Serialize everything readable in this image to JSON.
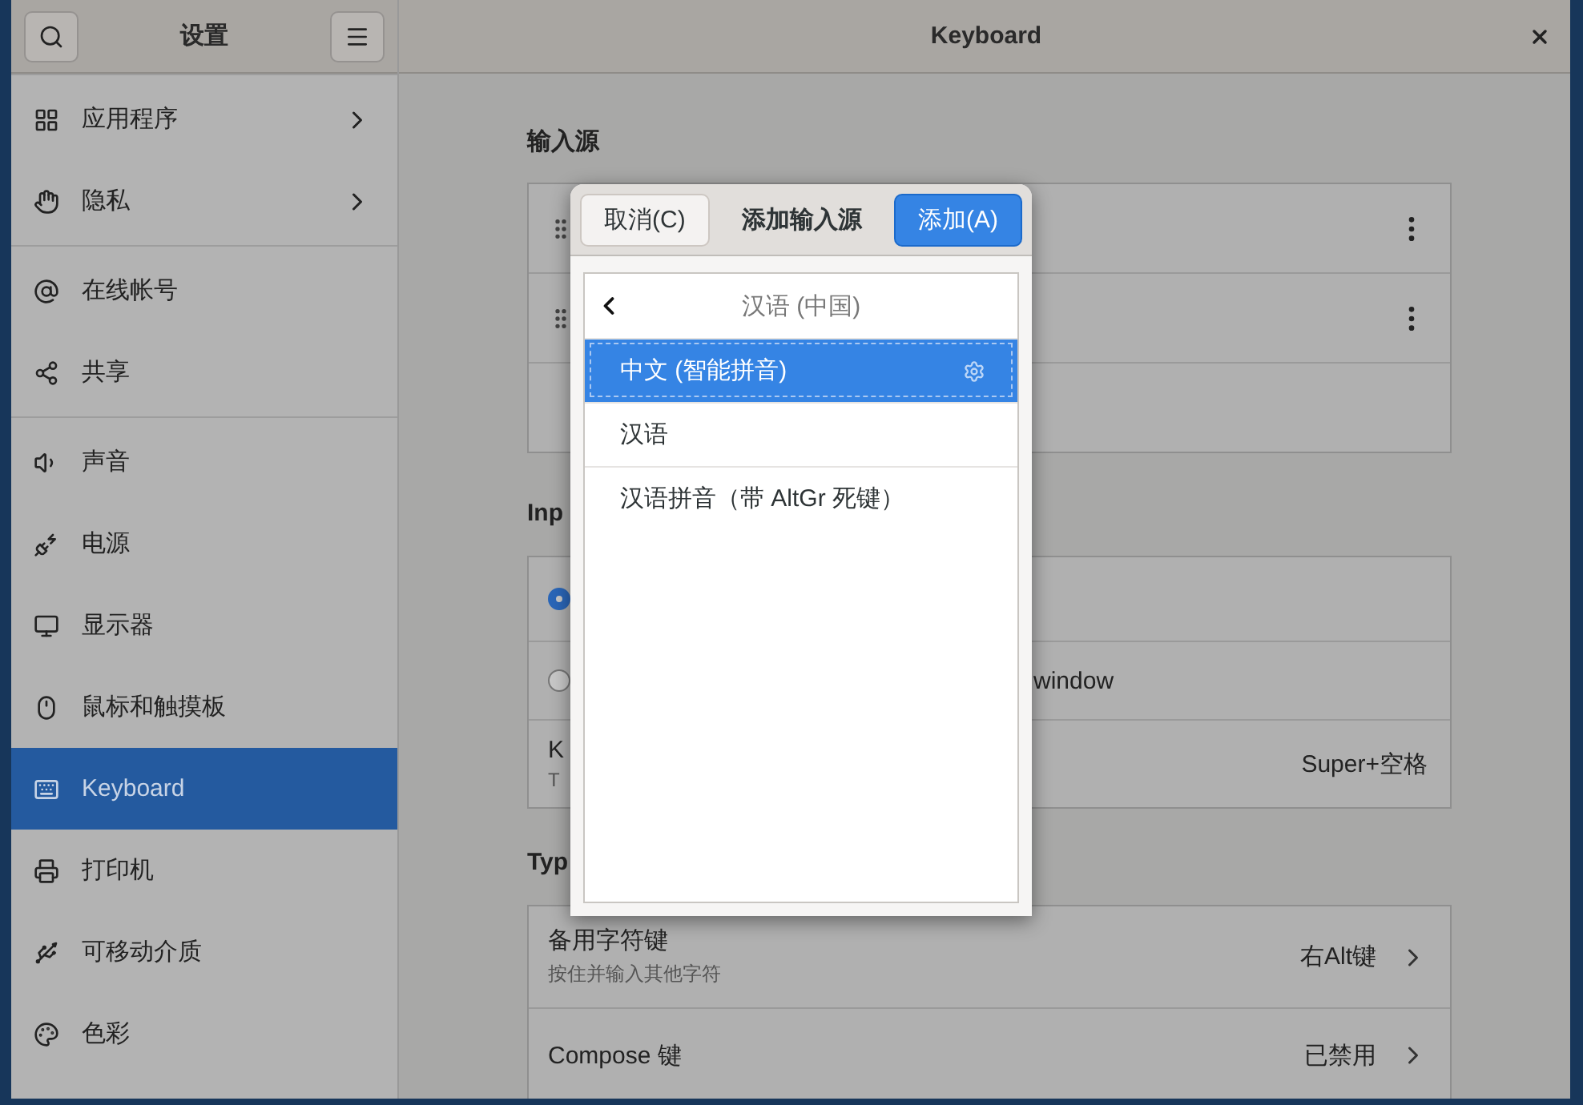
{
  "sidebar": {
    "title": "设置",
    "groups": [
      [
        {
          "label": "应用程序",
          "arrow": true,
          "selected": false
        },
        {
          "label": "隐私",
          "arrow": true,
          "selected": false
        }
      ],
      [
        {
          "label": "在线帐号",
          "arrow": false,
          "selected": false
        },
        {
          "label": "共享",
          "arrow": false,
          "selected": false
        }
      ],
      [
        {
          "label": "声音",
          "arrow": false,
          "selected": false
        },
        {
          "label": "电源",
          "arrow": false,
          "selected": false
        },
        {
          "label": "显示器",
          "arrow": false,
          "selected": false
        },
        {
          "label": "鼠标和触摸板",
          "arrow": false,
          "selected": false
        },
        {
          "label": "Keyboard",
          "arrow": false,
          "selected": true
        },
        {
          "label": "打印机",
          "arrow": false,
          "selected": false
        },
        {
          "label": "可移动介质",
          "arrow": false,
          "selected": false
        },
        {
          "label": "色彩",
          "arrow": false,
          "selected": false
        }
      ]
    ]
  },
  "main": {
    "title": "Keyboard",
    "sections": [
      {
        "title": "输入源",
        "rows": [
          {
            "kind": "source"
          },
          {
            "kind": "source"
          },
          {
            "kind": "empty"
          }
        ]
      },
      {
        "title": "Inp",
        "rows": [
          {
            "kind": "radio",
            "selected": true
          },
          {
            "kind": "radio",
            "selected": false,
            "label": "window"
          },
          {
            "kind": "shortcut",
            "label": "K",
            "sublabel": "T",
            "value": "Super+空格"
          }
        ]
      },
      {
        "title": "Typ",
        "rows": [
          {
            "kind": "link",
            "label": "备用字符键",
            "sublabel": "按住并输入其他字符",
            "value": "右Alt键"
          },
          {
            "kind": "link",
            "label": "Compose 键",
            "value": "已禁用"
          }
        ]
      }
    ]
  },
  "dialog": {
    "cancel": "取消(C)",
    "title": "添加输入源",
    "add": "添加(A)",
    "list_title": "汉语 (中国)",
    "items": [
      {
        "label": "中文 (智能拼音)",
        "selected": true,
        "settings": true
      },
      {
        "label": "汉语",
        "selected": false,
        "settings": false
      },
      {
        "label": "汉语拼音（带 AltGr 死键）",
        "selected": false,
        "settings": false
      }
    ]
  }
}
